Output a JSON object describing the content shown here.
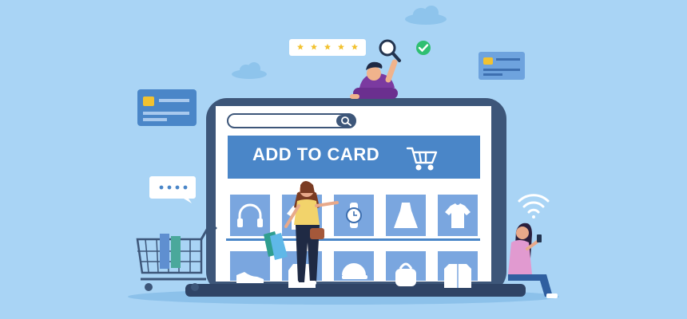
{
  "banner": {
    "label": "ADD TO CARD"
  },
  "search": {
    "placeholder": ""
  },
  "rating": {
    "stars": 5,
    "filled": 5
  },
  "icons": {
    "search": "search-icon",
    "cart": "cart-icon",
    "magnifier": "magnifier-icon",
    "check": "check-badge-icon",
    "chat": "chat-bubble-icon",
    "wifi": "wifi-icon",
    "credit_card": "credit-card-icon"
  },
  "products": [
    {
      "name": "headphones-icon"
    },
    {
      "name": "hoodie-icon"
    },
    {
      "name": "watch-icon"
    },
    {
      "name": "dress-icon"
    },
    {
      "name": "tshirt-icon"
    },
    {
      "name": "sneaker-icon"
    },
    {
      "name": "jacket-icon"
    },
    {
      "name": "cap-icon"
    },
    {
      "name": "bag-icon"
    },
    {
      "name": "shirt-icon"
    }
  ],
  "colors": {
    "background": "#a9d4f5",
    "accent": "#4a86c8",
    "dark_frame": "#3d5679",
    "tile": "#7aa6df",
    "success": "#2fbf71",
    "stars": "#f2c230"
  }
}
